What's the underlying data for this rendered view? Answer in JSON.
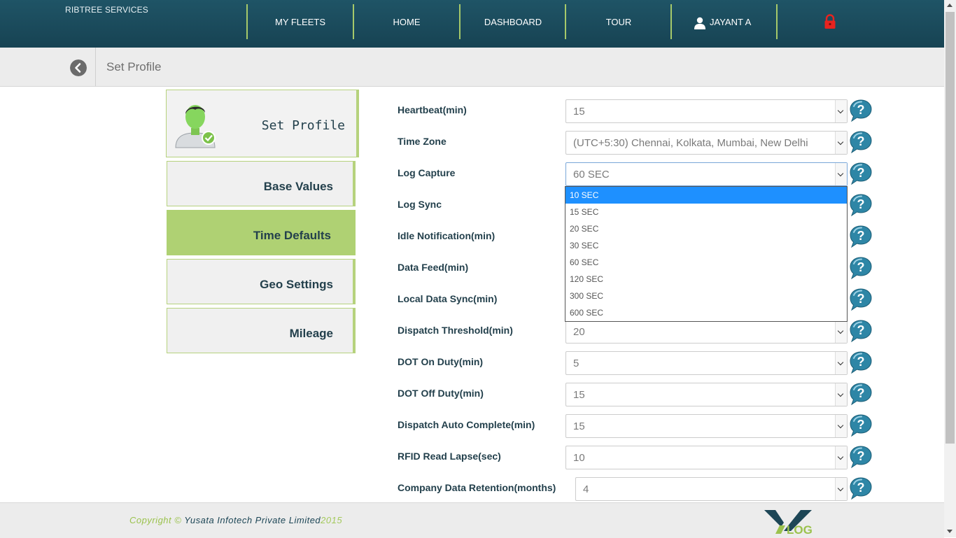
{
  "header": {
    "brand": "RIBTREE SERVICES",
    "nav": [
      "MY FLEETS",
      "HOME",
      "DASHBOARD",
      "TOUR"
    ],
    "user_name": "JAYANT A",
    "icons": {
      "user": "user-icon",
      "logout": "lock-icon"
    }
  },
  "breadcrumb": {
    "title": "Set Profile",
    "back_icon": "chevron-left-icon"
  },
  "sidebar": {
    "profile_label": "Set Profile",
    "items": [
      {
        "label": "Base Values",
        "active": false
      },
      {
        "label": "Time Defaults",
        "active": true
      },
      {
        "label": "Geo Settings",
        "active": false
      },
      {
        "label": "Mileage",
        "active": false
      }
    ]
  },
  "form": {
    "fields": [
      {
        "label": "Heartbeat(min)",
        "value": "15"
      },
      {
        "label": "Time Zone",
        "value": "(UTC+5:30) Chennai, Kolkata, Mumbai, New Delhi"
      },
      {
        "label": "Log Capture",
        "value": "60 SEC"
      },
      {
        "label": "Log Sync",
        "value": ""
      },
      {
        "label": "Idle Notification(min)",
        "value": ""
      },
      {
        "label": "Data Feed(min)",
        "value": ""
      },
      {
        "label": "Local Data Sync(min)",
        "value": ""
      },
      {
        "label": "Dispatch Threshold(min)",
        "value": "20"
      },
      {
        "label": "DOT On Duty(min)",
        "value": "5"
      },
      {
        "label": "DOT Off Duty(min)",
        "value": "15"
      },
      {
        "label": "Dispatch Auto Complete(min)",
        "value": "15"
      },
      {
        "label": "RFID Read Lapse(sec)",
        "value": "10"
      },
      {
        "label": "Company Data Retention(months)",
        "value": "4"
      }
    ],
    "open_dropdown": {
      "field": "Log Capture",
      "options": [
        "10 SEC",
        "15 SEC",
        "20 SEC",
        "30 SEC",
        "60 SEC",
        "120 SEC",
        "300 SEC",
        "600 SEC"
      ],
      "highlighted": "10 SEC"
    }
  },
  "footer": {
    "copyright_prefix": "Copyright ©",
    "company": " Yusata Infotech Private Limited",
    "year": "2015",
    "logo_text": "LOG"
  },
  "colors": {
    "header_bg": "#1d4e5f",
    "accent_green": "#afd173",
    "text_dark": "#23404c",
    "help_blue": "#2e86a6",
    "highlight": "#1e90ff"
  }
}
